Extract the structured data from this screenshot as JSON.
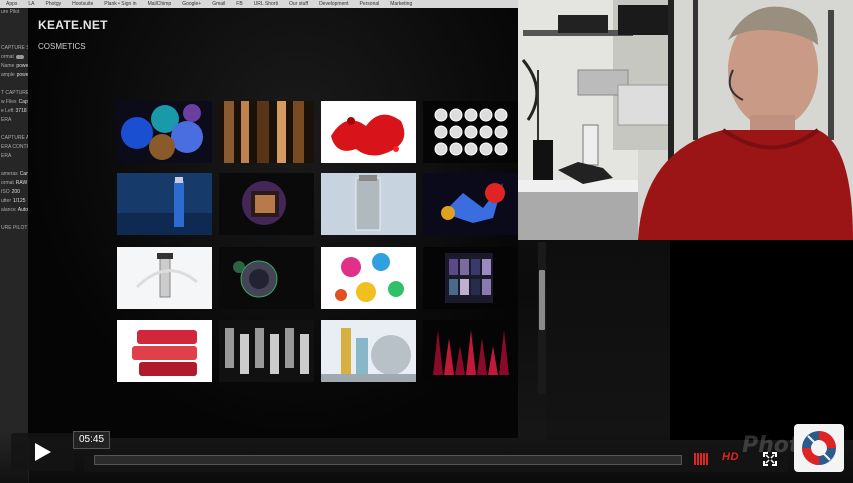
{
  "browser": {
    "bookmarks": [
      "Apps",
      "LA",
      "Photgy",
      "Hootsuite",
      "Plank • Sign in",
      "MailChimp",
      "Google+",
      "Gmail",
      "FB",
      "URL Shorti",
      "Our stuff",
      "Development",
      "Personal",
      "Marketing"
    ]
  },
  "capture_panel": {
    "rows": [
      "ure Pilot",
      "",
      "",
      "",
      "CAPTURE SE",
      "ormat",
      "Name",
      "ample",
      "",
      "T CAPTURE LO",
      "w Files",
      "e Left",
      "ERA",
      "",
      "CAPTURE ADJ",
      "ERA CONTROL",
      "ERA",
      "",
      "ameras",
      "ormat",
      "ISO",
      "utter",
      "alance",
      "",
      "URE PILOT"
    ],
    "values": [
      "",
      "",
      "",
      "",
      "",
      "",
      "powe",
      "powe",
      "",
      "",
      "Capt",
      "3718",
      "",
      "",
      "",
      "",
      "",
      "",
      "Cano",
      "RAW",
      "200",
      "1/125",
      "Auto",
      "",
      ""
    ]
  },
  "site": {
    "title": "KEATE.NET",
    "section": "COSMETICS",
    "thumbnails": [
      "blue-eyeshadow-pots",
      "bronze-brushes",
      "red-powder-splash",
      "chrome-spheres",
      "blue-serum-bottle",
      "eyeshadow-compact-glow",
      "silver-bottle",
      "colorful-brush-burst",
      "glass-serum-dropper",
      "dark-compact-burst",
      "nail-polish-splash",
      "eyeshadow-palette",
      "red-lipsticks",
      "silver-lipsticks",
      "skincare-set",
      "red-lipstick-flower"
    ]
  },
  "player": {
    "time": "05:45",
    "progress": 0.0,
    "quality_label": "HD",
    "watermark": "Photgy",
    "accent_color": "#e02424"
  },
  "icons": {
    "play": "play-icon",
    "volume": "volume-icon",
    "fullscreen": "fullscreen-icon",
    "logo": "shutter-logo-icon"
  }
}
